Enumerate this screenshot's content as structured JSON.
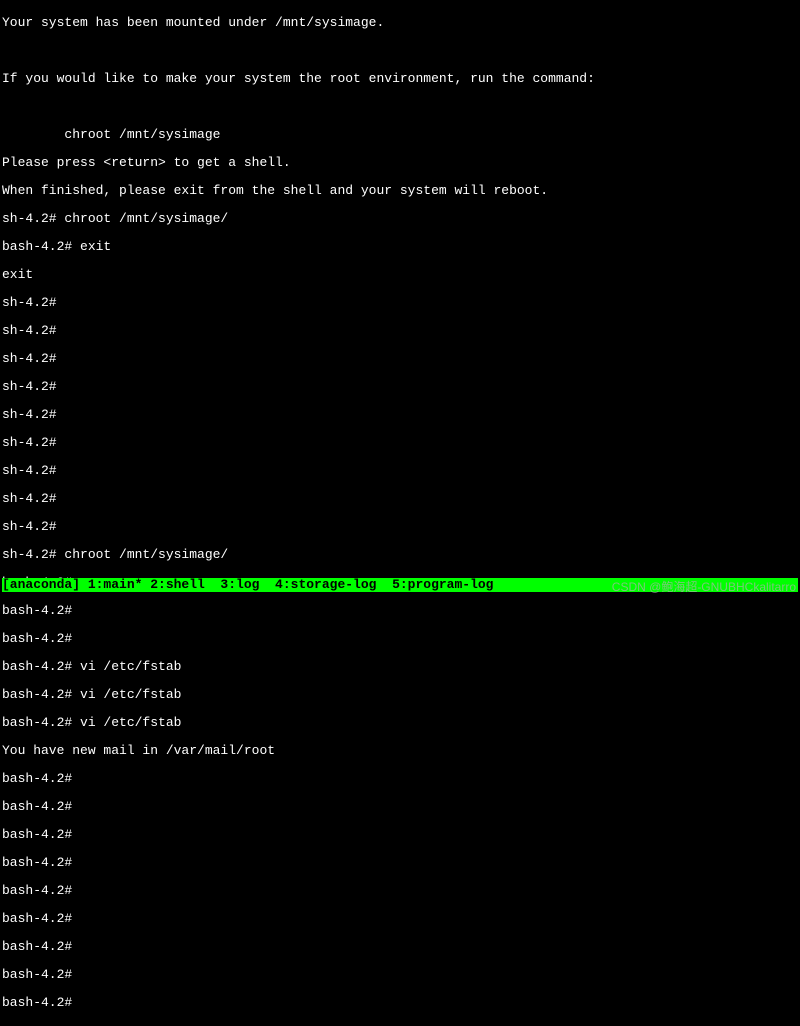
{
  "terminal": {
    "lines": [
      "Your system has been mounted under /mnt/sysimage.",
      "",
      "If you would like to make your system the root environment, run the command:",
      "",
      "        chroot /mnt/sysimage",
      "Please press <return> to get a shell.",
      "When finished, please exit from the shell and your system will reboot.",
      "sh-4.2# chroot /mnt/sysimage/",
      "bash-4.2# exit",
      "exit",
      "sh-4.2#",
      "sh-4.2#",
      "sh-4.2#",
      "sh-4.2#",
      "sh-4.2#",
      "sh-4.2#",
      "sh-4.2#",
      "sh-4.2#",
      "sh-4.2#",
      "sh-4.2# chroot /mnt/sysimage/",
      "bash-4.2#",
      "bash-4.2#",
      "bash-4.2#",
      "bash-4.2# vi /etc/fstab",
      "bash-4.2# vi /etc/fstab",
      "bash-4.2# vi /etc/fstab",
      "You have new mail in /var/mail/root",
      "bash-4.2#",
      "bash-4.2#",
      "bash-4.2#",
      "bash-4.2#",
      "bash-4.2#",
      "bash-4.2#",
      "bash-4.2#",
      "bash-4.2#",
      "bash-4.2#"
    ]
  },
  "statusbar": {
    "text": "[anaconda] 1:main* 2:shell  3:log  4:storage-log  5:program-log                                        "
  },
  "watermark": {
    "text": "CSDN @鲍海超-GNUBHCkalitarro"
  }
}
